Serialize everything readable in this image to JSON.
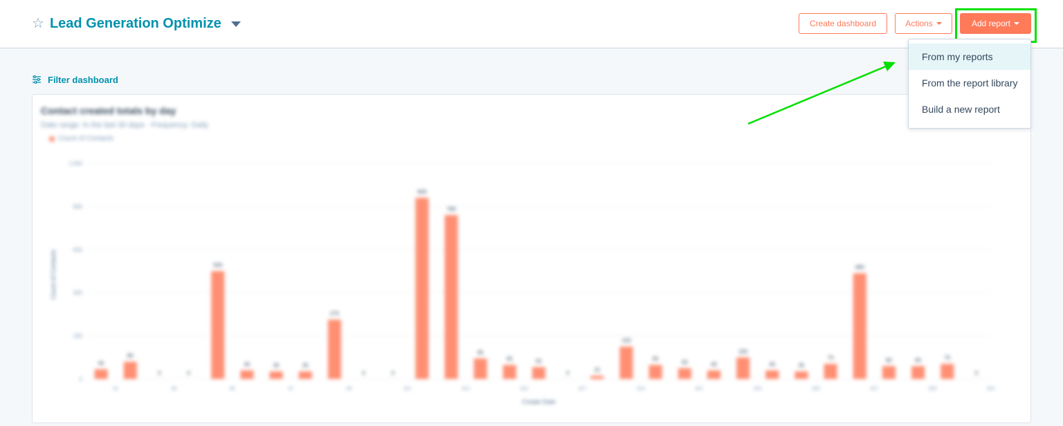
{
  "header": {
    "title": "Lead Generation Optimize",
    "create_dashboard_label": "Create dashboard",
    "actions_label": "Actions",
    "add_report_label": "Add report"
  },
  "dropdown": {
    "items": [
      {
        "label": "From my reports"
      },
      {
        "label": "From the report library"
      },
      {
        "label": "Build a new report"
      }
    ]
  },
  "filter": {
    "label": "Filter dashboard"
  },
  "report": {
    "title": "Contact created totals by day",
    "subtitle": "Date range: In the last 30 days   ·   Frequency: Daily",
    "legend": "Count of Contacts"
  },
  "colors": {
    "accent": "#ff7a59",
    "link": "#0091ae",
    "highlight": "#00e000",
    "bar": "#ff8f73"
  },
  "chart_data": {
    "type": "bar",
    "title": "Contact created totals by day",
    "xlabel": "Create Date",
    "ylabel": "Count of Contacts",
    "ylim": [
      0,
      1000
    ],
    "yticks": [
      0,
      200,
      400,
      600,
      800,
      1000
    ],
    "legend": [
      "Count of Contacts"
    ],
    "categories": [
      "d1",
      "d2",
      "d3",
      "d4",
      "d5",
      "d6",
      "d7",
      "d8",
      "d9",
      "d10",
      "d11",
      "d12",
      "d13",
      "d14",
      "d15",
      "d16",
      "d17",
      "d18",
      "d19",
      "d20",
      "d21",
      "d22",
      "d23",
      "d24",
      "d25",
      "d26",
      "d27",
      "d28",
      "d29",
      "d30",
      "d31"
    ],
    "values": [
      45,
      80,
      0,
      0,
      500,
      40,
      35,
      35,
      275,
      0,
      0,
      840,
      760,
      95,
      65,
      55,
      0,
      15,
      150,
      65,
      50,
      40,
      100,
      40,
      35,
      70,
      490,
      60,
      60,
      70,
      0
    ]
  }
}
